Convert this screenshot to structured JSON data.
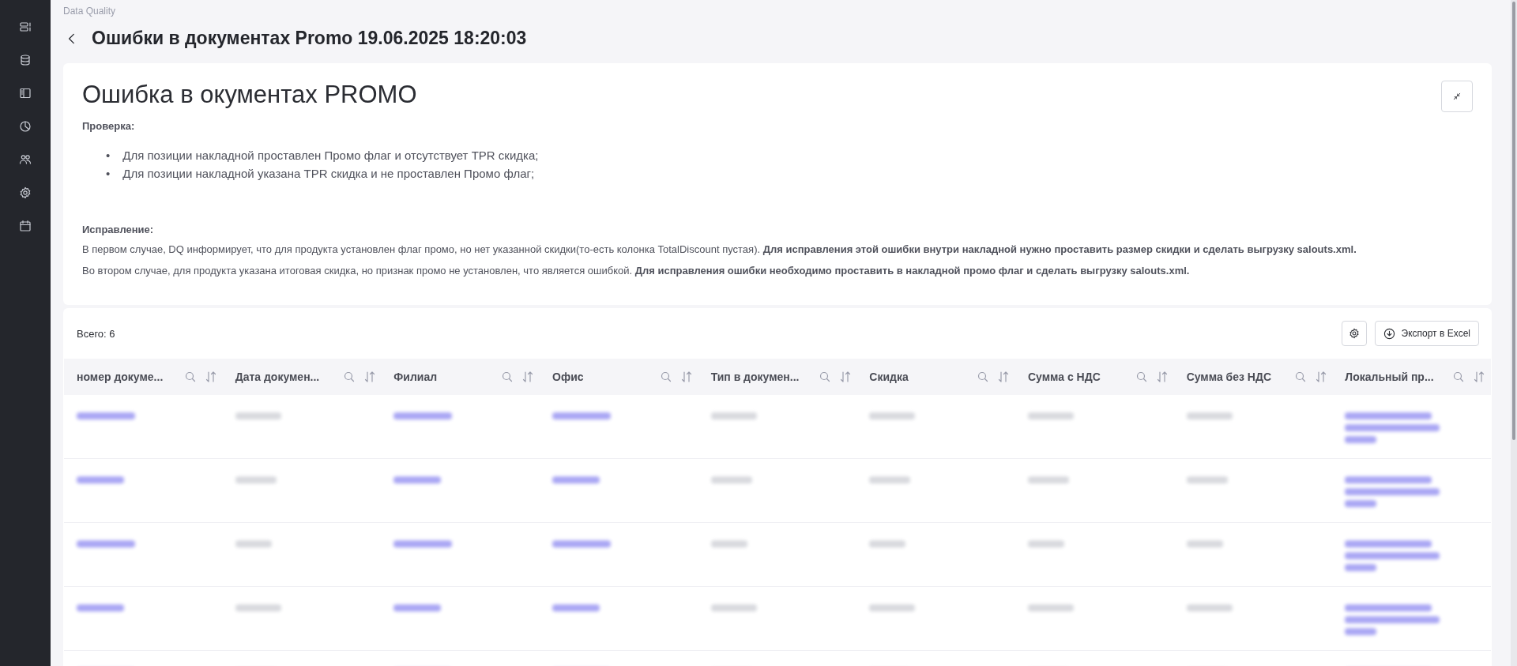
{
  "breadcrumb": "Data Quality",
  "title": "Ошибки в документах Promo 19.06.2025 18:20:03",
  "description": {
    "heading": "Ошибка в окументах PROMO",
    "check_label": "Проверка:",
    "check_items": [
      {
        "marker": "•",
        "text": "Для позиции накладной проставлен Промо флаг и отсутствует TPR скидка;"
      },
      {
        "marker": "•",
        "text": "Для позиции накладной указана TPR скидка и не проставлен Промо флаг;"
      }
    ],
    "fix_label": "Исправление:",
    "fix_paragraphs": [
      "В первом случае, DQ информирует, что для продукта установлен флаг промо, но нет указанной скидки(то-есть колонка TotalDiscount пустая). **Для исправления этой ошибки внутри накладной нужно проставить размер скидки и сделать выгрузку salouts.xml.**",
      "Во втором случае, для продукта указана итоговая скидка, но признак промо не установлен, что является ошибкой. **Для исправления ошибки необходимо проставить в накладной промо флаг и сделать выгрузку salouts.xml.**"
    ]
  },
  "table": {
    "total": "Всего: 6",
    "export_button": "Экспорт в Excel",
    "columns": [
      {
        "label": "номер докуме...",
        "kind": "link"
      },
      {
        "label": "Дата докумен...",
        "kind": "text"
      },
      {
        "label": "Филиал",
        "kind": "link"
      },
      {
        "label": "Офис",
        "kind": "link"
      },
      {
        "label": "Тип в докумен...",
        "kind": "text"
      },
      {
        "label": "Скидка",
        "kind": "text"
      },
      {
        "label": "Сумма с НДС",
        "kind": "text"
      },
      {
        "label": "Сумма без НДС",
        "kind": "text"
      },
      {
        "label": "Локальный пр...",
        "kind": "multiline"
      }
    ]
  }
}
